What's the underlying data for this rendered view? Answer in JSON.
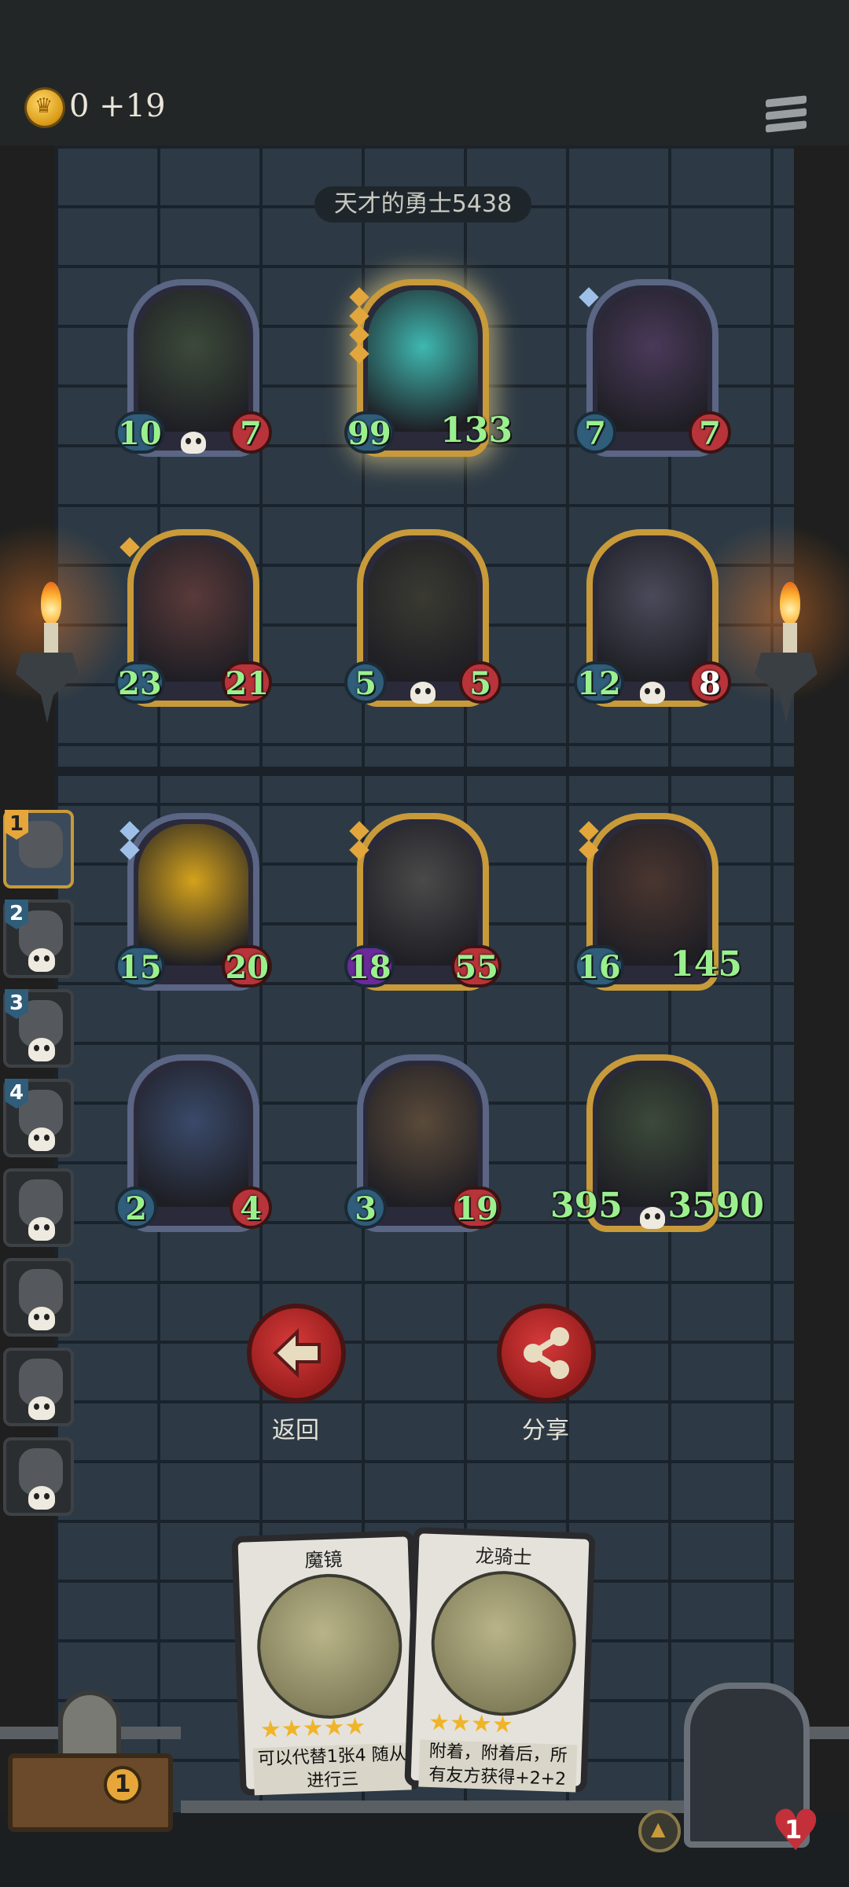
{
  "header": {
    "coins": "0",
    "coins_delta": "+19",
    "coin_text": "0 +19"
  },
  "player": {
    "name": "天才的勇士5438"
  },
  "board": [
    {
      "atk": "10",
      "hp": "7",
      "frame": "silver",
      "gems": 0,
      "skull": true
    },
    {
      "atk": "99",
      "hp": "133",
      "frame": "gold",
      "gems": 4,
      "skull": false,
      "highlight": true
    },
    {
      "atk": "7",
      "hp": "7",
      "frame": "silver",
      "gems": 1,
      "gem_color": "blue",
      "skull": false
    },
    {
      "atk": "23",
      "hp": "21",
      "frame": "gold",
      "gems": 1,
      "skull": false
    },
    {
      "atk": "5",
      "hp": "5",
      "frame": "gold",
      "gems": 0,
      "skull": true
    },
    {
      "atk": "12",
      "hp": "8",
      "frame": "gold",
      "gems": 0,
      "skull": true
    },
    {
      "atk": "15",
      "hp": "20",
      "frame": "silver",
      "gems": 2,
      "gem_color": "blue",
      "skull": false
    },
    {
      "atk": "18",
      "hp": "55",
      "frame": "gold",
      "gems": 2,
      "skull": false,
      "atk_style": "purple"
    },
    {
      "atk": "16",
      "hp": "145",
      "frame": "gold",
      "gems": 2,
      "skull": false
    },
    {
      "atk": "2",
      "hp": "4",
      "frame": "silver",
      "gems": 0,
      "skull": false
    },
    {
      "atk": "3",
      "hp": "19",
      "frame": "silver",
      "gems": 0,
      "skull": false
    },
    {
      "atk": "395",
      "hp": "3590",
      "frame": "gold",
      "gems": 0,
      "skull": true
    }
  ],
  "sidebar": [
    {
      "rank": "1",
      "active": true
    },
    {
      "rank": "2"
    },
    {
      "rank": "3"
    },
    {
      "rank": "4"
    },
    {
      "rank": ""
    },
    {
      "rank": ""
    },
    {
      "rank": ""
    },
    {
      "rank": ""
    }
  ],
  "actions": {
    "back_label": "返回",
    "share_label": "分享"
  },
  "hand": [
    {
      "title": "魔镜",
      "stars": "★★★★★",
      "desc": "可以代替1张4 随从进行三"
    },
    {
      "title": "龙骑士",
      "stars": "★★★★",
      "desc": "附着，附着后，所 有友方获得+2+2"
    }
  ],
  "chest": {
    "count": "1"
  },
  "hero": {
    "health": "1"
  },
  "colors": {
    "gold_frame": "#c89a3a",
    "silver_frame": "#5b6584",
    "hp_red": "#b8343a",
    "atk_blue": "#2f5d7a",
    "stat_text": "#9bf08e"
  }
}
